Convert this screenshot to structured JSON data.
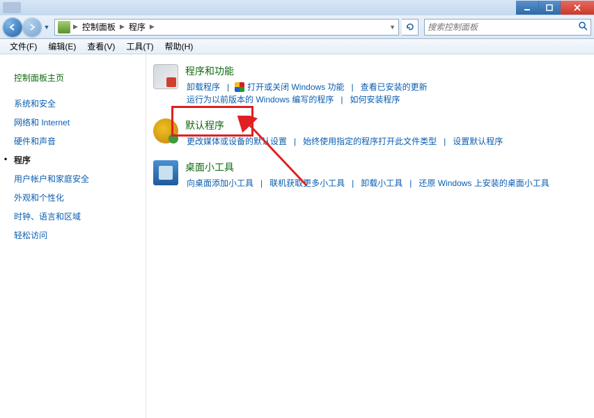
{
  "breadcrumb": {
    "control_panel": "控制面板",
    "programs": "程序"
  },
  "search": {
    "placeholder": "搜索控制面板"
  },
  "menu": {
    "file": "文件(F)",
    "edit": "编辑(E)",
    "view": "查看(V)",
    "tools": "工具(T)",
    "help": "帮助(H)"
  },
  "sidebar": {
    "home": "控制面板主页",
    "items": [
      "系统和安全",
      "网络和 Internet",
      "硬件和声音",
      "程序",
      "用户帐户和家庭安全",
      "外观和个性化",
      "时钟、语言和区域",
      "轻松访问"
    ]
  },
  "sections": {
    "programs": {
      "title": "程序和功能",
      "links": {
        "uninstall": "卸载程序",
        "features": "打开或关闭 Windows 功能",
        "updates": "查看已安装的更新",
        "compat": "运行为以前版本的 Windows 编写的程序",
        "howto": "如何安装程序"
      }
    },
    "default": {
      "title": "默认程序",
      "links": {
        "media": "更改媒体或设备的默认设置",
        "assoc": "始终使用指定的程序打开此文件类型",
        "setdef": "设置默认程序"
      }
    },
    "gadgets": {
      "title": "桌面小工具",
      "links": {
        "add": "向桌面添加小工具",
        "more": "联机获取更多小工具",
        "uninstall": "卸载小工具",
        "restore": "还原 Windows 上安装的桌面小工具"
      }
    }
  }
}
